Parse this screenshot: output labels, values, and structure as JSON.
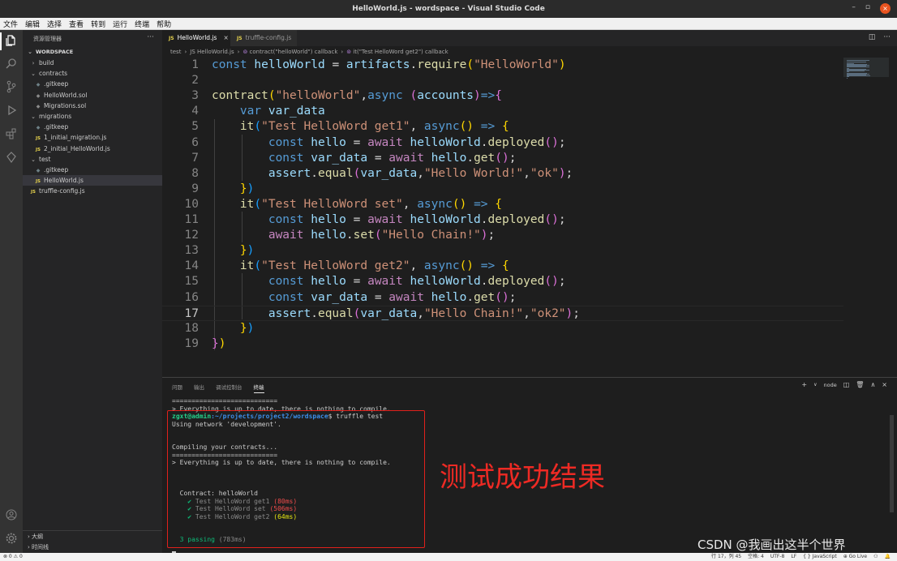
{
  "window": {
    "title": "HelloWorld.js - wordspace - Visual Studio Code",
    "controls": [
      "–",
      "▫",
      "×"
    ]
  },
  "menu": [
    "文件",
    "编辑",
    "选择",
    "查看",
    "转到",
    "运行",
    "终端",
    "帮助"
  ],
  "sidebar": {
    "title": "资源管理器",
    "more": "···",
    "workspace": "WORDSPACE",
    "items": [
      {
        "label": "build",
        "type": "folder",
        "depth": 1
      },
      {
        "label": "contracts",
        "type": "folder-open",
        "depth": 1
      },
      {
        "label": ".gitkeep",
        "type": "git",
        "depth": 2
      },
      {
        "label": "HelloWorld.sol",
        "type": "sol",
        "depth": 2
      },
      {
        "label": "Migrations.sol",
        "type": "sol",
        "depth": 2
      },
      {
        "label": "migrations",
        "type": "folder-open",
        "depth": 1
      },
      {
        "label": ".gitkeep",
        "type": "git",
        "depth": 2
      },
      {
        "label": "1_initial_migration.js",
        "type": "js",
        "depth": 2
      },
      {
        "label": "2_initial_HelloWorld.js",
        "type": "js",
        "depth": 2
      },
      {
        "label": "test",
        "type": "folder-open",
        "depth": 1
      },
      {
        "label": ".gitkeep",
        "type": "git",
        "depth": 2
      },
      {
        "label": "HelloWorld.js",
        "type": "js",
        "depth": 2,
        "selected": true
      },
      {
        "label": "truffle-config.js",
        "type": "js",
        "depth": 1
      }
    ],
    "outline": "大纲",
    "timeline": "时间线"
  },
  "tabs": [
    {
      "label": "HelloWorld.js",
      "icon": "JS",
      "active": true,
      "close": "×"
    },
    {
      "label": "truffle-config.js",
      "icon": "JS",
      "active": false
    }
  ],
  "breadcrumbs": [
    "test",
    "JS HelloWorld.js",
    "contract(\"helloWorld\") callback",
    "it(\"Test HelloWord get2\") callback"
  ],
  "editor": {
    "current_line": 17,
    "lines": [
      {
        "n": "1",
        "html": "<span class='k'>const</span> <span class='v'>helloWorld</span> <span class='p'>=</span> <span class='v'>artifacts</span><span class='p'>.</span><span class='f'>require</span><span class='b1'>(</span><span class='s'>\"HelloWorld\"</span><span class='b1'>)</span>"
      },
      {
        "n": "2",
        "html": ""
      },
      {
        "n": "3",
        "html": "<span class='f'>contract</span><span class='b1'>(</span><span class='s'>\"helloWorld\"</span><span class='p'>,</span><span class='k'>async</span> <span class='b2'>(</span><span class='v'>accounts</span><span class='b2'>)</span><span class='k'>=&gt;</span><span class='b2'>{</span>"
      },
      {
        "n": "4",
        "html": "    <span class='k'>var</span> <span class='v'>var_data</span>"
      },
      {
        "n": "5",
        "html": "    <span class='f'>it</span><span class='b3'>(</span><span class='s'>\"Test HelloWord get1\"</span><span class='p'>,</span> <span class='k'>async</span><span class='b1'>()</span> <span class='k'>=&gt;</span> <span class='b1'>{</span>"
      },
      {
        "n": "6",
        "html": "        <span class='k'>const</span> <span class='v'>hello</span> <span class='p'>=</span> <span class='kw2'>await</span> <span class='v'>helloWorld</span><span class='p'>.</span><span class='f'>deployed</span><span class='b2'>()</span><span class='p'>;</span>"
      },
      {
        "n": "7",
        "html": "        <span class='k'>const</span> <span class='v'>var_data</span> <span class='p'>=</span> <span class='kw2'>await</span> <span class='v'>hello</span><span class='p'>.</span><span class='f'>get</span><span class='b2'>()</span><span class='p'>;</span>"
      },
      {
        "n": "8",
        "html": "        <span class='v'>assert</span><span class='p'>.</span><span class='f'>equal</span><span class='b2'>(</span><span class='v'>var_data</span><span class='p'>,</span><span class='s'>\"Hello World!\"</span><span class='p'>,</span><span class='s'>\"ok\"</span><span class='b2'>)</span><span class='p'>;</span>"
      },
      {
        "n": "9",
        "html": "    <span class='b1'>}</span><span class='b3'>)</span>"
      },
      {
        "n": "10",
        "html": "    <span class='f'>it</span><span class='b3'>(</span><span class='s'>\"Test HelloWord set\"</span><span class='p'>,</span> <span class='k'>async</span><span class='b1'>()</span> <span class='k'>=&gt;</span> <span class='b1'>{</span>"
      },
      {
        "n": "11",
        "html": "        <span class='k'>const</span> <span class='v'>hello</span> <span class='p'>=</span> <span class='kw2'>await</span> <span class='v'>helloWorld</span><span class='p'>.</span><span class='f'>deployed</span><span class='b2'>()</span><span class='p'>;</span>"
      },
      {
        "n": "12",
        "html": "        <span class='kw2'>await</span> <span class='v'>hello</span><span class='p'>.</span><span class='f'>set</span><span class='b2'>(</span><span class='s'>\"Hello Chain!\"</span><span class='b2'>)</span><span class='p'>;</span>"
      },
      {
        "n": "13",
        "html": "    <span class='b1'>}</span><span class='b3'>)</span>"
      },
      {
        "n": "14",
        "html": "    <span class='f'>it</span><span class='b3'>(</span><span class='s'>\"Test HelloWord get2\"</span><span class='p'>,</span> <span class='k'>async</span><span class='b1'>()</span> <span class='k'>=&gt;</span> <span class='b1'>{</span>"
      },
      {
        "n": "15",
        "html": "        <span class='k'>const</span> <span class='v'>hello</span> <span class='p'>=</span> <span class='kw2'>await</span> <span class='v'>helloWorld</span><span class='p'>.</span><span class='f'>deployed</span><span class='b2'>()</span><span class='p'>;</span>"
      },
      {
        "n": "16",
        "html": "        <span class='k'>const</span> <span class='v'>var_data</span> <span class='p'>=</span> <span class='kw2'>await</span> <span class='v'>hello</span><span class='p'>.</span><span class='f'>get</span><span class='b2'>()</span><span class='p'>;</span>"
      },
      {
        "n": "17",
        "html": "        <span class='v'>assert</span><span class='p'>.</span><span class='f'>equal</span><span class='b2'>(</span><span class='v'>var_data</span><span class='p'>,</span><span class='s'>\"Hello Chain!\"</span><span class='p'>,</span><span class='s'>\"ok2\"</span><span class='b2'>)</span><span class='p'>;</span>"
      },
      {
        "n": "18",
        "html": "    <span class='b1'>}</span><span class='b3'>)</span>"
      },
      {
        "n": "19",
        "html": "<span class='b2'>}</span><span class='b1'>)</span>"
      }
    ]
  },
  "panel": {
    "tabs": [
      "问题",
      "输出",
      "调试控制台",
      "终端"
    ],
    "active_tab": "终端",
    "shell": "node",
    "actions": [
      "+",
      "∨",
      "node",
      "◫",
      "🗑",
      "∧",
      "×"
    ],
    "terminal_lines": [
      {
        "cls": "",
        "text": "==========================="
      },
      {
        "cls": "",
        "text": "> Everything is up to date, there is nothing to compile."
      },
      {
        "cls": "prompt",
        "user": "zgxt@admin",
        "path": ":~/projects/project2/wordspace",
        "cmd": "$ truffle test"
      },
      {
        "cls": "",
        "text": "Using network 'development'."
      },
      {
        "cls": "",
        "text": ""
      },
      {
        "cls": "",
        "text": ""
      },
      {
        "cls": "",
        "text": "Compiling your contracts..."
      },
      {
        "cls": "",
        "text": "==========================="
      },
      {
        "cls": "",
        "text": "> Everything is up to date, there is nothing to compile."
      },
      {
        "cls": "",
        "text": ""
      },
      {
        "cls": "",
        "text": ""
      },
      {
        "cls": "",
        "text": ""
      },
      {
        "cls": "",
        "text": "  Contract: helloWorld"
      },
      {
        "cls": "test",
        "name": "Test HelloWord get1",
        "time": "(80ms)",
        "color": "tred"
      },
      {
        "cls": "test",
        "name": "Test HelloWord set",
        "time": "(506ms)",
        "color": "tred"
      },
      {
        "cls": "test",
        "name": "Test HelloWord get2",
        "time": "(64ms)",
        "color": "tyellow"
      },
      {
        "cls": "",
        "text": ""
      },
      {
        "cls": "",
        "text": ""
      },
      {
        "cls": "passing",
        "text": "  3 passing",
        "time": " (783ms)"
      },
      {
        "cls": "",
        "text": ""
      },
      {
        "cls": "cursor",
        "text": ""
      }
    ],
    "annotation": "测试成功结果"
  },
  "status": {
    "left": "⊗ 0 ⚠ 0",
    "right": [
      "行 17，列 45",
      "空格: 4",
      "UTF-8",
      "LF",
      "{ } JavaScript",
      "⊕ Go Live",
      "⚇",
      "🔔"
    ]
  },
  "watermark": "CSDN @我画出这半个世界"
}
